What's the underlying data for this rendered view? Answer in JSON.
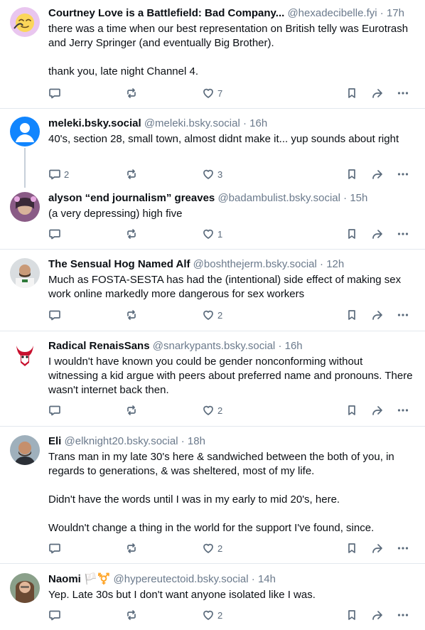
{
  "posts": [
    {
      "name": "Courtney Love is a Battlefield: Bad Company...",
      "handle": "@hexadecibelle.fyi",
      "dot": "·",
      "time": "17h",
      "text": "there was a time when our best representation on British telly was Eurotrash and Jerry Springer (and eventually Big Brother).\n\nthank you, late night Channel 4.",
      "replies": "",
      "likes": "7"
    },
    {
      "name": "meleki.bsky.social",
      "handle": "@meleki.bsky.social",
      "dot": "·",
      "time": "16h",
      "text": "40's, section 28, small town, almost didnt make it... yup sounds about right",
      "replies": "2",
      "likes": "3"
    },
    {
      "name": "alyson “end journalism” greaves",
      "handle": "@badambulist.bsky.social",
      "dot": "·",
      "time": "15h",
      "text": "(a very depressing) high five",
      "replies": "",
      "likes": "1"
    },
    {
      "name": "The Sensual Hog Named Alf",
      "handle": "@boshthejerm.bsky.social",
      "dot": "·",
      "time": "12h",
      "text": "Much as FOSTA-SESTA has had the (intentional) side effect of making sex work online markedly more dangerous for sex workers",
      "replies": "",
      "likes": "2"
    },
    {
      "name": "Radical RenaisSans",
      "handle": "@snarkypants.bsky.social",
      "dot": "·",
      "time": "16h",
      "text": "I wouldn't have known you could be gender nonconforming without witnessing a kid argue with peers about preferred name and pronouns. There wasn't internet back then.",
      "replies": "",
      "likes": "2"
    },
    {
      "name": "Eli",
      "handle": "@elknight20.bsky.social",
      "dot": "·",
      "time": "18h",
      "text": "Trans man in my late 30's here & sandwiched between the both of you, in regards to generations, & was sheltered, most of my life.\n\nDidn't have the words until I was in my early to mid 20's, here.\n\nWouldn't change a thing in the world for the support I've found, since.",
      "replies": "",
      "likes": "2"
    },
    {
      "name": "Naomi 🏳️⚧️",
      "handle": "@hypereutectoid.bsky.social",
      "dot": "·",
      "time": "14h",
      "text": "Yep. Late 30s but I don't want anyone isolated like I was.",
      "replies": "",
      "likes": "2"
    }
  ],
  "icons": {
    "reply": "reply-icon",
    "repost": "repost-icon",
    "like": "heart-icon",
    "bookmark": "bookmark-icon",
    "share": "share-icon",
    "more": "more-icon"
  },
  "colors": {
    "text": "#0b0f14",
    "muted": "#6b7a8c",
    "icon": "#5b6b7c",
    "separator": "#e3e8ee",
    "default_avatar": "#1185fe"
  }
}
